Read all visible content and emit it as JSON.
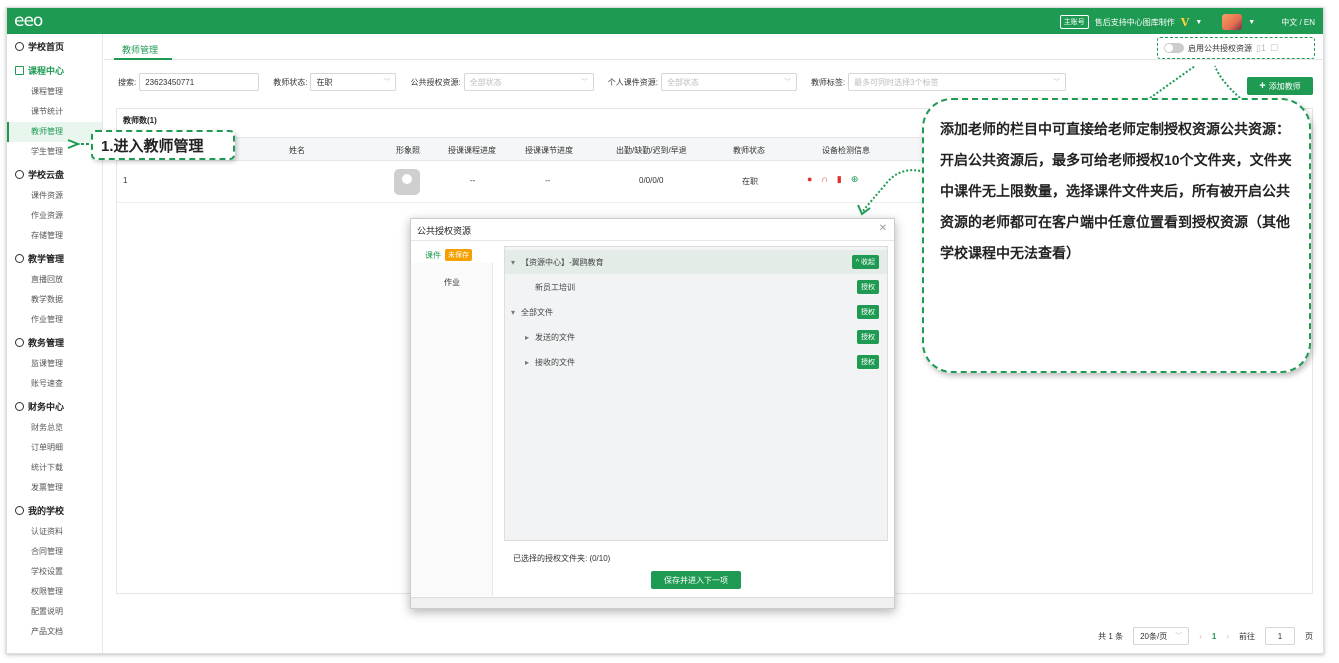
{
  "app": {
    "logo": "eeo"
  },
  "topbar": {
    "account_badge": "主账号",
    "org_name": "售后支持中心图库制作",
    "vip": "V",
    "lang": "中文 / EN"
  },
  "sidebar": {
    "sections": [
      {
        "label": "学校首页",
        "items": []
      },
      {
        "label": "课程中心",
        "items": [
          "课程管理",
          "课节统计",
          "教师管理",
          "学生管理"
        ]
      },
      {
        "label": "学校云盘",
        "items": [
          "课件资源",
          "作业资源",
          "存储管理"
        ]
      },
      {
        "label": "教学管理",
        "items": [
          "直播回放",
          "教学数据",
          "作业管理"
        ]
      },
      {
        "label": "教务管理",
        "items": [
          "监课管理",
          "账号速查"
        ]
      },
      {
        "label": "财务中心",
        "items": [
          "财务总览",
          "订单明细",
          "统计下载",
          "发票管理"
        ]
      },
      {
        "label": "我的学校",
        "items": [
          "认证资料",
          "合同管理",
          "学校设置",
          "权限管理",
          "配置说明",
          "产品文档"
        ]
      }
    ]
  },
  "tabs": {
    "active": "教师管理"
  },
  "public_switch": {
    "label": "启用公共授权资源"
  },
  "filters": {
    "search_label": "搜索:",
    "search_value": "23623450771",
    "status_label": "教师状态:",
    "status_value": "在职",
    "public_label": "公共授权资源:",
    "public_value": "全部状态",
    "personal_label": "个人课件资源:",
    "personal_value": "全部状态",
    "tag_label": "教师标签:",
    "tag_placeholder": "最多可同时选择3个标签"
  },
  "add_teacher": "添加教师",
  "table": {
    "count": "教师数(1)",
    "columns": [
      "姓名",
      "形象照",
      "授课课程进度",
      "授课课节进度",
      "出勤/缺勤/迟到/早退",
      "教师状态",
      "设备检测信息"
    ],
    "rows": [
      {
        "index": "1",
        "course": "--",
        "lesson": "--",
        "attendance": "0/0/0/0",
        "status": "在职"
      }
    ]
  },
  "pager": {
    "total": "共 1 条",
    "size": "20条/页",
    "page": "1",
    "goto": "前往",
    "goto_value": "1",
    "unit": "页"
  },
  "modal": {
    "title": "公共授权资源",
    "tab_courseware": "课件",
    "unsaved": "未保存",
    "tab_homework": "作业",
    "tree": [
      {
        "label": "【资源中心】-翼鸥教育",
        "btn": "收起"
      },
      {
        "label": "新员工培训",
        "btn": "授权"
      },
      {
        "label": "全部文件",
        "btn": "授权"
      },
      {
        "label": "发送的文件",
        "btn": "授权"
      },
      {
        "label": "接收的文件",
        "btn": "授权"
      }
    ],
    "selected": "已选择的授权文件夹: (0/10)",
    "save": "保存并进入下一项"
  },
  "callout_step": "1.进入教师管理",
  "callout_note": "添加老师的栏目中可直接给老师定制授权资源公共资源：开启公共资源后，最多可给老师授权10个文件夹，文件夹中课件无上限数量，选择课件文件夹后，所有被开启公共资源的老师都可在客户端中任意位置看到授权资源（其他学校课程中无法查看）"
}
